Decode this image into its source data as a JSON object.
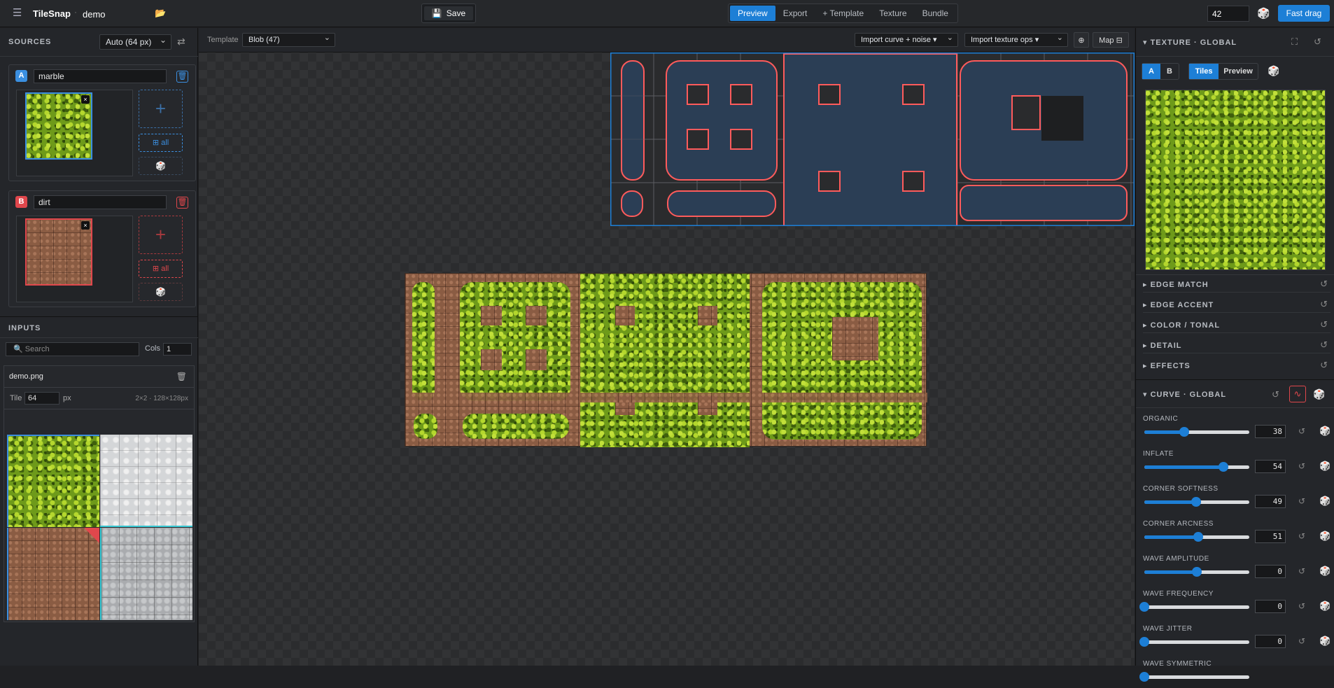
{
  "topbar": {
    "menu_icon": "hamburger-menu-icon",
    "app_name": "TileSnap",
    "separator": "·",
    "project_name": "demo",
    "open_icon": "folder-open-icon",
    "save_label": "Save",
    "save_icon": "floppy-disk-icon",
    "tabs": [
      "Preview",
      "Export",
      "+ Template",
      "Texture",
      "Bundle"
    ],
    "active_tab": "Preview",
    "seed_value": "42",
    "dice_icon": "dice-icon",
    "fast_drag_label": "Fast drag"
  },
  "sources": {
    "title": "SOURCES",
    "size_select": "Auto (64 px)",
    "swap_icon": "swap-icon",
    "a": {
      "badge": "A",
      "name": "marble",
      "all_label": "⊞ all",
      "plus": "+",
      "color": "#3b8fe0"
    },
    "b": {
      "badge": "B",
      "name": "dirt",
      "all_label": "⊞ all",
      "plus": "+",
      "color": "#e0474c"
    }
  },
  "inputs": {
    "title": "INPUTS",
    "search_placeholder": "🔍 Search",
    "cols_label": "Cols",
    "cols_value": "1",
    "file_name": "demo.png",
    "tile_label": "Tile",
    "tile_value": "64",
    "tile_unit": "px",
    "grid_info": "2×2 · 128×128px"
  },
  "canvas": {
    "template_label": "Template",
    "template_select": "Blob (47)",
    "import_curve_label": "Import curve + noise ▾",
    "import_texture_label": "Import texture ops ▾",
    "target_icon": "crosshair-icon",
    "map_label": "Map ⊟"
  },
  "texture_panel": {
    "title": "TEXTURE · GLOBAL",
    "expand_icon": "expand-icon",
    "reset_icon": "reset-icon",
    "ab_options": [
      "A",
      "B"
    ],
    "ab_active": "A",
    "view_options": [
      "Tiles",
      "Preview"
    ],
    "view_active": "Tiles",
    "sections": [
      "EDGE MATCH",
      "EDGE ACCENT",
      "COLOR / TONAL",
      "DETAIL",
      "EFFECTS"
    ],
    "curve_title": "CURVE · GLOBAL"
  },
  "sliders": [
    {
      "label": "ORGANIC",
      "value": 38,
      "pct": 0.38
    },
    {
      "label": "INFLATE",
      "value": 54,
      "pct": 0.75
    },
    {
      "label": "CORNER SOFTNESS",
      "value": 49,
      "pct": 0.49
    },
    {
      "label": "CORNER ARCNESS",
      "value": 51,
      "pct": 0.51
    },
    {
      "label": "WAVE AMPLITUDE",
      "value": 0,
      "pct": 0.5
    },
    {
      "label": "WAVE FREQUENCY",
      "value": 0,
      "pct": 0.0
    },
    {
      "label": "WAVE JITTER",
      "value": 0,
      "pct": 0.0
    },
    {
      "label": "WAVE SYMMETRIC",
      "value": "",
      "pct": 0.0
    }
  ],
  "colors": {
    "accent": "#1d7fd6",
    "source_a": "#3b8fe0",
    "source_b": "#e0474c",
    "outline": "#ff5b5b",
    "blob_fill": "#2b3e55"
  }
}
